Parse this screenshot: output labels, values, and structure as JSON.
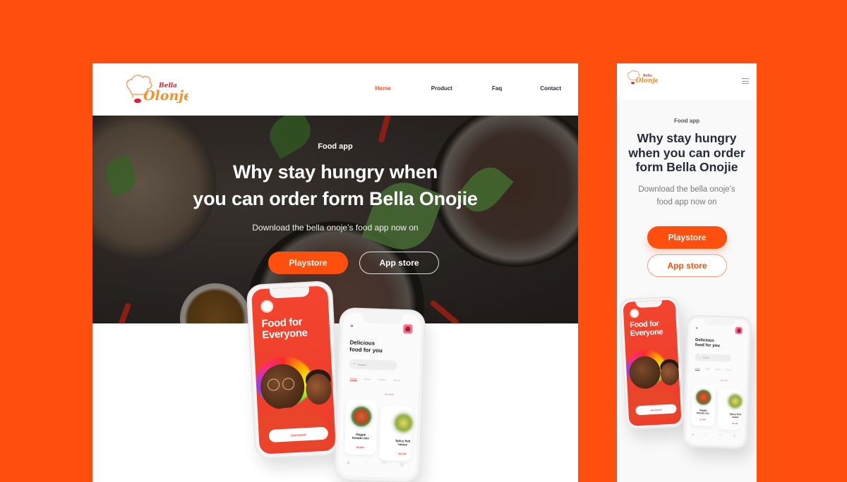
{
  "colors": {
    "background": "#ff4f0f",
    "accent": "#ff4f0f",
    "nav_active": "#f15a24",
    "phone_red": "#ef3d2b"
  },
  "brand": {
    "name_top": "Bella",
    "name_main": "Olonje"
  },
  "desktop": {
    "nav": {
      "items": [
        {
          "label": "Home",
          "active": true
        },
        {
          "label": "Product",
          "active": false
        },
        {
          "label": "Faq",
          "active": false
        },
        {
          "label": "Contact",
          "active": false
        }
      ]
    },
    "hero": {
      "kicker": "Food app",
      "title_line1": "Why stay hungry when",
      "title_line2": "you can order form Bella Onojie",
      "subtitle": "Download the bella onoje’s food app now on",
      "primary_button": "Playstore",
      "secondary_button": "App store"
    }
  },
  "mobile": {
    "menu_icon": "hamburger-icon",
    "hero": {
      "kicker": "Food app",
      "title_line1": "Why stay hungry",
      "title_line2": "when you can order",
      "title_line3": "form Bella Onojie",
      "subtitle_line1": "Download the bella onoje’s",
      "subtitle_line2": "food app now on",
      "primary_button": "Playstore",
      "secondary_button": "App store"
    }
  },
  "phone_onboarding": {
    "title_line1": "Food for",
    "title_line2": "Everyone",
    "cta": "Get started"
  },
  "phone_home": {
    "menu_icon": "menu-icon",
    "title_line1": "Delicious",
    "title_line2": "food for you",
    "search_placeholder": "Search",
    "tabs": [
      "Foods",
      "Drinks",
      "Snacks",
      "Sauce"
    ],
    "see_more": "see more",
    "items": [
      {
        "name_line1": "Veggie",
        "name_line2": "tomato mix",
        "price": "N1,900"
      },
      {
        "name_line1": "Spicy fish",
        "name_line2": "sauce",
        "price": "N2,300"
      }
    ],
    "bottom_nav": [
      "home-icon",
      "heart-icon",
      "cart-icon",
      "history-icon"
    ]
  }
}
